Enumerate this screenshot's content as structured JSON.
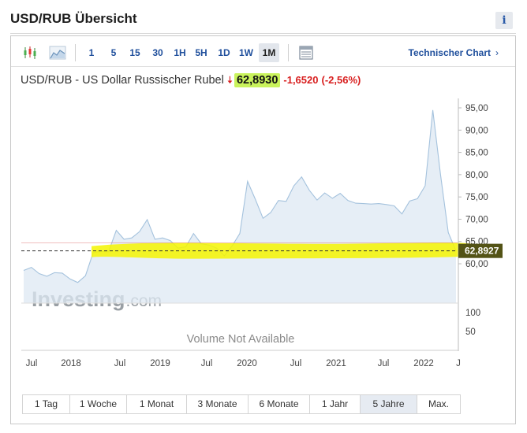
{
  "header": {
    "title": "USD/RUB Übersicht",
    "info_label": "i"
  },
  "toolbar": {
    "chart_types": [
      "candlestick-icon",
      "area-chart-icon"
    ],
    "timeframes": [
      {
        "label": "1",
        "active": false
      },
      {
        "label": "5",
        "active": false
      },
      {
        "label": "15",
        "active": false
      },
      {
        "label": "30",
        "active": false
      },
      {
        "label": "1H",
        "active": false
      },
      {
        "label": "5H",
        "active": false
      },
      {
        "label": "1D",
        "active": false
      },
      {
        "label": "1W",
        "active": false
      },
      {
        "label": "1M",
        "active": true
      }
    ],
    "table_icon": "table-icon",
    "technical_chart_label": "Technischer Chart",
    "technical_chart_arrow": "›"
  },
  "instrument": {
    "name": "USD/RUB - US Dollar Russischer Rubel",
    "direction": "down",
    "price": "62,8930",
    "change": "-1,6520",
    "change_pct": "(-2,56%)"
  },
  "colors": {
    "accent": "#1f4f9c",
    "down": "#d81e1e",
    "price_highlight": "#c9f35c",
    "marker_highlight": "#f5f500",
    "area_fill": "#dde8f3",
    "area_line": "#a4c2dd"
  },
  "chart_data": {
    "type": "area",
    "series": [
      {
        "values": [
          58.5,
          59.2,
          57.8,
          57.2,
          58.0,
          57.9,
          56.6,
          55.8,
          57.3,
          62.5,
          62.8,
          62.7,
          67.5,
          65.5,
          65.8,
          67.2,
          69.9,
          65.5,
          65.8,
          65.2,
          63.5,
          63.8,
          66.8,
          64.5,
          64.2,
          63.5,
          61.8,
          64.0,
          66.8,
          78.5,
          74.5,
          70.2,
          71.5,
          74.2,
          74.0,
          77.5,
          79.5,
          76.5,
          74.3,
          75.9,
          74.7,
          75.8,
          74.2,
          73.6,
          73.5,
          73.4,
          73.5,
          73.3,
          73.0,
          71.2,
          74.1,
          74.6,
          77.5,
          94.5,
          80.0,
          67.0,
          62.9
        ]
      }
    ],
    "y_ticks": [
      "95,00",
      "90,00",
      "85,00",
      "80,00",
      "75,00",
      "70,00",
      "65,00",
      "60,00"
    ],
    "ylim": [
      57,
      95
    ],
    "last_value_label": "62,8927",
    "last_value": 62.8927,
    "x_tick_labels": [
      "Jul",
      "2018",
      "Jul",
      "2019",
      "Jul",
      "2020",
      "Jul",
      "2021",
      "Jul",
      "2022",
      "J"
    ],
    "volume": {
      "y_ticks": [
        "100",
        "50"
      ],
      "message": "Volume Not Available"
    },
    "watermark": {
      "brand": "Investing",
      "suffix": ".com"
    },
    "grid": false
  },
  "range_selector": [
    {
      "label": "1 Tag",
      "active": false
    },
    {
      "label": "1 Woche",
      "active": false
    },
    {
      "label": "1 Monat",
      "active": false
    },
    {
      "label": "3 Monate",
      "active": false
    },
    {
      "label": "6 Monate",
      "active": false
    },
    {
      "label": "1 Jahr",
      "active": false
    },
    {
      "label": "5 Jahre",
      "active": true
    },
    {
      "label": "Max.",
      "active": false
    }
  ]
}
